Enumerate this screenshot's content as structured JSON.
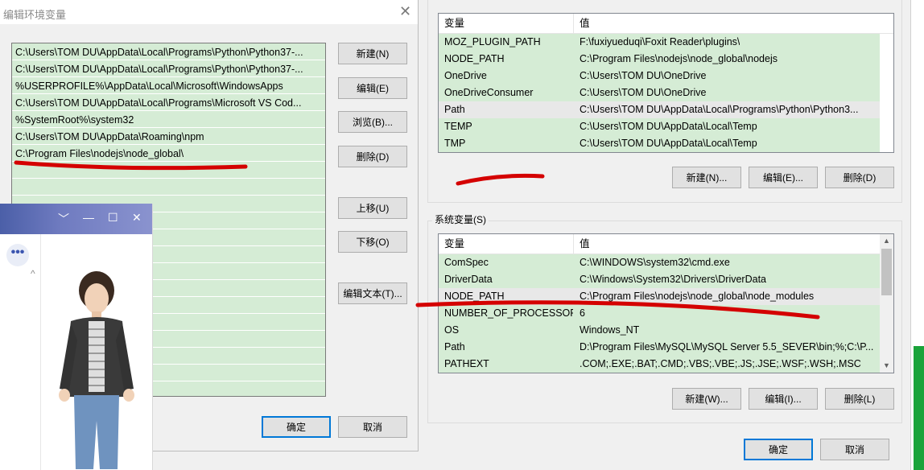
{
  "edit_dialog": {
    "title": "编辑环境变量",
    "close_glyph": "✕",
    "path_entries": [
      "C:\\Users\\TOM DU\\AppData\\Local\\Programs\\Python\\Python37-...",
      "C:\\Users\\TOM DU\\AppData\\Local\\Programs\\Python\\Python37-...",
      "%USERPROFILE%\\AppData\\Local\\Microsoft\\WindowsApps",
      "C:\\Users\\TOM DU\\AppData\\Local\\Programs\\Microsoft VS Cod...",
      "%SystemRoot%\\system32",
      "C:\\Users\\TOM DU\\AppData\\Roaming\\npm",
      "C:\\Program Files\\nodejs\\node_global\\"
    ],
    "buttons": {
      "new": "新建(N)",
      "edit": "编辑(E)",
      "browse": "浏览(B)...",
      "delete": "删除(D)",
      "move_up": "上移(U)",
      "move_down": "下移(O)",
      "edit_text": "编辑文本(T)...",
      "ok": "确定",
      "cancel": "取消"
    }
  },
  "user_vars": {
    "columns": [
      "变量",
      "值"
    ],
    "rows": [
      {
        "name": "MOZ_PLUGIN_PATH",
        "value": "F:\\fuxiyueduqi\\Foxit Reader\\plugins\\"
      },
      {
        "name": "NODE_PATH",
        "value": "C:\\Program Files\\nodejs\\node_global\\nodejs"
      },
      {
        "name": "OneDrive",
        "value": "C:\\Users\\TOM DU\\OneDrive"
      },
      {
        "name": "OneDriveConsumer",
        "value": "C:\\Users\\TOM DU\\OneDrive"
      },
      {
        "name": "Path",
        "value": "C:\\Users\\TOM DU\\AppData\\Local\\Programs\\Python\\Python3..."
      },
      {
        "name": "TEMP",
        "value": "C:\\Users\\TOM DU\\AppData\\Local\\Temp"
      },
      {
        "name": "TMP",
        "value": "C:\\Users\\TOM DU\\AppData\\Local\\Temp"
      }
    ],
    "buttons": {
      "new": "新建(N)...",
      "edit": "编辑(E)...",
      "delete": "删除(D)"
    }
  },
  "system_vars": {
    "label": "系统变量(S)",
    "columns": [
      "变量",
      "值"
    ],
    "rows": [
      {
        "name": "ComSpec",
        "value": "C:\\WINDOWS\\system32\\cmd.exe"
      },
      {
        "name": "DriverData",
        "value": "C:\\Windows\\System32\\Drivers\\DriverData"
      },
      {
        "name": "NODE_PATH",
        "value": "C:\\Program Files\\nodejs\\node_global\\node_modules"
      },
      {
        "name": "NUMBER_OF_PROCESSORS",
        "value": "6"
      },
      {
        "name": "OS",
        "value": "Windows_NT"
      },
      {
        "name": "Path",
        "value": "D:\\Program Files\\MySQL\\MySQL Server 5.5_SEVER\\bin;%;C:\\P..."
      },
      {
        "name": "PATHEXT",
        "value": ".COM;.EXE;.BAT;.CMD;.VBS;.VBE;.JS;.JSE;.WSF;.WSH;.MSC"
      }
    ],
    "buttons": {
      "new": "新建(W)...",
      "edit": "编辑(I)...",
      "delete": "删除(L)"
    }
  },
  "footer": {
    "ok": "确定",
    "cancel": "取消"
  },
  "char_window": {
    "controls": [
      "﹀",
      "—",
      "☐",
      "✕"
    ],
    "more_glyph": "•••",
    "caret_glyph": "^"
  },
  "colors": {
    "row_green": "#d5ecd5",
    "annotation_red": "#d40000",
    "default_button_border": "#0078d7"
  }
}
